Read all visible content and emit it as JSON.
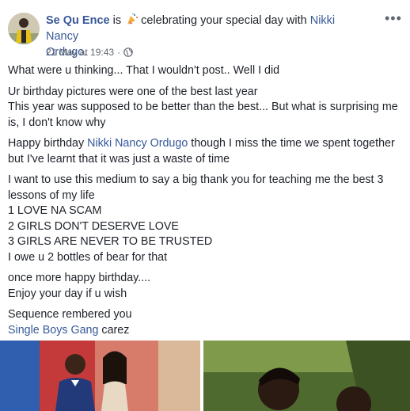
{
  "header": {
    "author": "Se Qu Ence",
    "is_word": " is",
    "activity": "celebrating your special day with",
    "tagged_line1": "Nikki Nancy",
    "tagged_line2": "Ordugo",
    "period": ".",
    "timestamp": "21 May at 19:43",
    "separator": " · ",
    "more_icon": "ellipsis-icon",
    "audience_icon": "globe-icon",
    "activity_icon": "party-popper-icon"
  },
  "body": {
    "p1": "What were u thinking... That I wouldn't post.. Well I did",
    "p2_l1": "Ur birthday pictures were one of the best last year",
    "p2_l2": "This year was supposed to be better than the best... But what is surprising me",
    "p2_l3": "is, I don't know why",
    "p3_pre": "Happy birthday ",
    "p3_link": "Nikki Nancy Ordugo",
    "p3_post": " though I miss the time we spent together",
    "p3_l2": "but I've learnt that it was just a waste of time",
    "p4_l1": "I want to use this medium to say a big thank you for teaching me the best 3",
    "p4_l2": "lessons of my life",
    "p4_l3": "1 LOVE NA SCAM",
    "p4_l4": "2 GIRLS DON'T DESERVE LOVE",
    "p4_l5": "3 GIRLS ARE NEVER TO BE TRUSTED",
    "p4_l6": "I owe u 2 bottles of bear for that",
    "p5_l1": "once more happy birthday....",
    "p5_l2": "Enjoy your day if u wish",
    "p6_l1": "Sequence rembered you",
    "p6_link": "Single Boys Gang",
    "p6_post": " carez"
  },
  "colors": {
    "link": "#385898",
    "text": "#1d2129",
    "meta": "#616770"
  }
}
